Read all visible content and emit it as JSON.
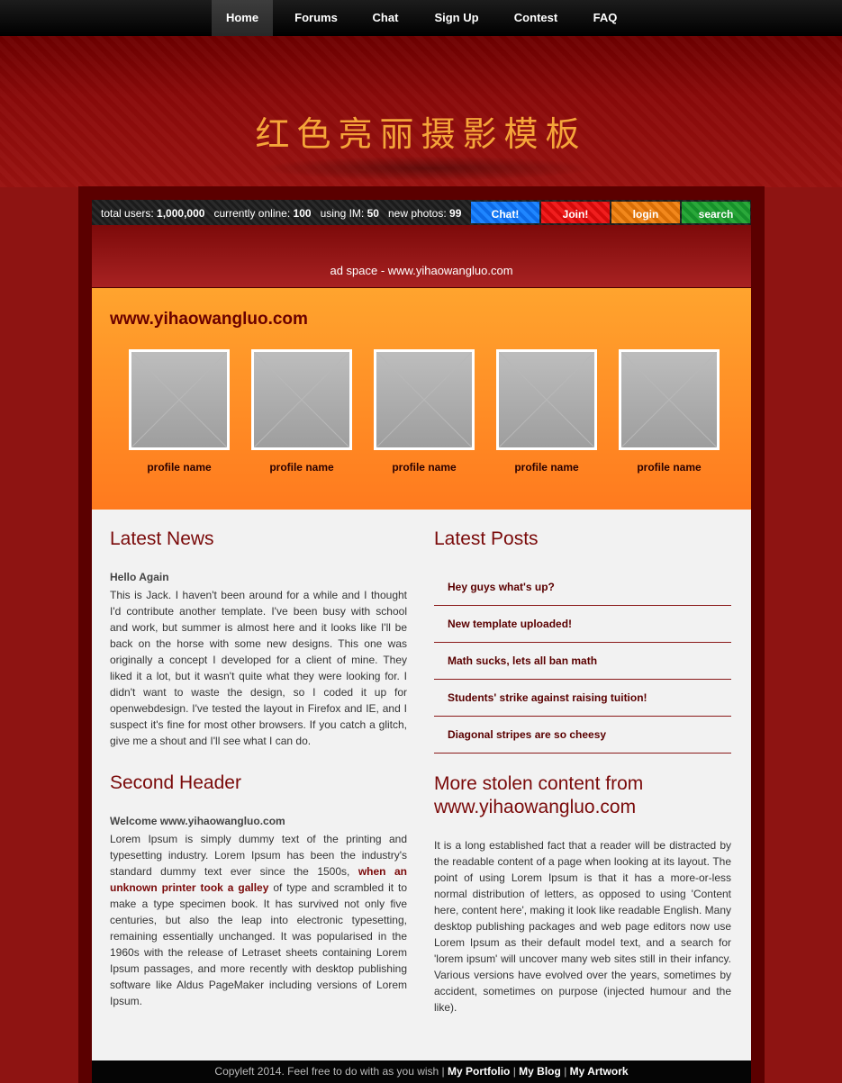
{
  "nav": {
    "items": [
      {
        "label": "Home"
      },
      {
        "label": "Forums"
      },
      {
        "label": "Chat"
      },
      {
        "label": "Sign Up"
      },
      {
        "label": "Contest"
      },
      {
        "label": "FAQ"
      }
    ],
    "active": "Home"
  },
  "header": {
    "title": "红色亮丽摄影模板"
  },
  "stats": {
    "total_users_label": "total users:",
    "total_users": "1,000,000",
    "online_label": "currently online:",
    "online": "100",
    "im_label": "using IM:",
    "im": "50",
    "photos_label": "new photos:",
    "photos": "99"
  },
  "toolbar": {
    "chat": "Chat!",
    "join": "Join!",
    "login": "login",
    "search": "search"
  },
  "ad": {
    "text": "ad space - www.yihaowangluo.com"
  },
  "featured": {
    "title": "www.yihaowangluo.com",
    "profiles": [
      {
        "name": "profile name"
      },
      {
        "name": "profile name"
      },
      {
        "name": "profile name"
      },
      {
        "name": "profile name"
      },
      {
        "name": "profile name"
      }
    ]
  },
  "news": {
    "heading": "Latest News",
    "subheading": "Hello Again",
    "body": "This is Jack. I haven't been around for a while and I thought I'd contribute another template. I've been busy with school and work, but summer is almost here and it looks like I'll be back on the horse with some new designs. This one was originally a concept I developed for a client of mine. They liked it a lot, but it wasn't quite what they were looking for. I didn't want to waste the design, so I coded it up for openwebdesign. I've tested the layout in Firefox and IE, and I suspect it's fine for most other browsers. If you catch a glitch, give me a shout and I'll see what I can do."
  },
  "second": {
    "heading": "Second Header",
    "subheading": "Welcome www.yihaowangluo.com",
    "body_before": "Lorem Ipsum is simply dummy text of the printing and typesetting industry. Lorem Ipsum has been the industry's standard dummy text ever since the 1500s, ",
    "link": "when an unknown printer took a galley",
    "body_after": " of type and scrambled it to make a type specimen book. It has survived not only five centuries, but also the leap into electronic typesetting, remaining essentially unchanged. It was popularised in the 1960s with the release of Letraset sheets containing Lorem Ipsum passages, and more recently with desktop publishing software like Aldus PageMaker including versions of Lorem Ipsum."
  },
  "posts": {
    "heading": "Latest Posts",
    "items": [
      {
        "title": "Hey guys what's up?"
      },
      {
        "title": "New template uploaded!"
      },
      {
        "title": "Math sucks, lets all ban math"
      },
      {
        "title": "Students' strike against raising tuition!"
      },
      {
        "title": "Diagonal stripes are so cheesy"
      }
    ]
  },
  "more": {
    "heading": "More stolen content from www.yihaowangluo.com",
    "body": "It is a long established fact that a reader will be distracted by the readable content of a page when looking at its layout. The point of using Lorem Ipsum is that it has a more-or-less normal distribution of letters, as opposed to using 'Content here, content here', making it look like readable English. Many desktop publishing packages and web page editors now use Lorem Ipsum as their default model text, and a search for 'lorem ipsum' will uncover many web sites still in their infancy. Various versions have evolved over the years, sometimes by accident, sometimes on purpose (injected humour and the like)."
  },
  "footer": {
    "text": "Copyleft 2014. Feel free to do with as you wish |",
    "link1": "My Portfolio",
    "sep": "|",
    "link2": "My Blog",
    "link3": "My Artwork"
  },
  "colors": {
    "page_bg": "#8e1412",
    "accent_orange": "#ff8a22",
    "heading_red": "#7a0a0a",
    "title_gold": "#f5a53a"
  }
}
